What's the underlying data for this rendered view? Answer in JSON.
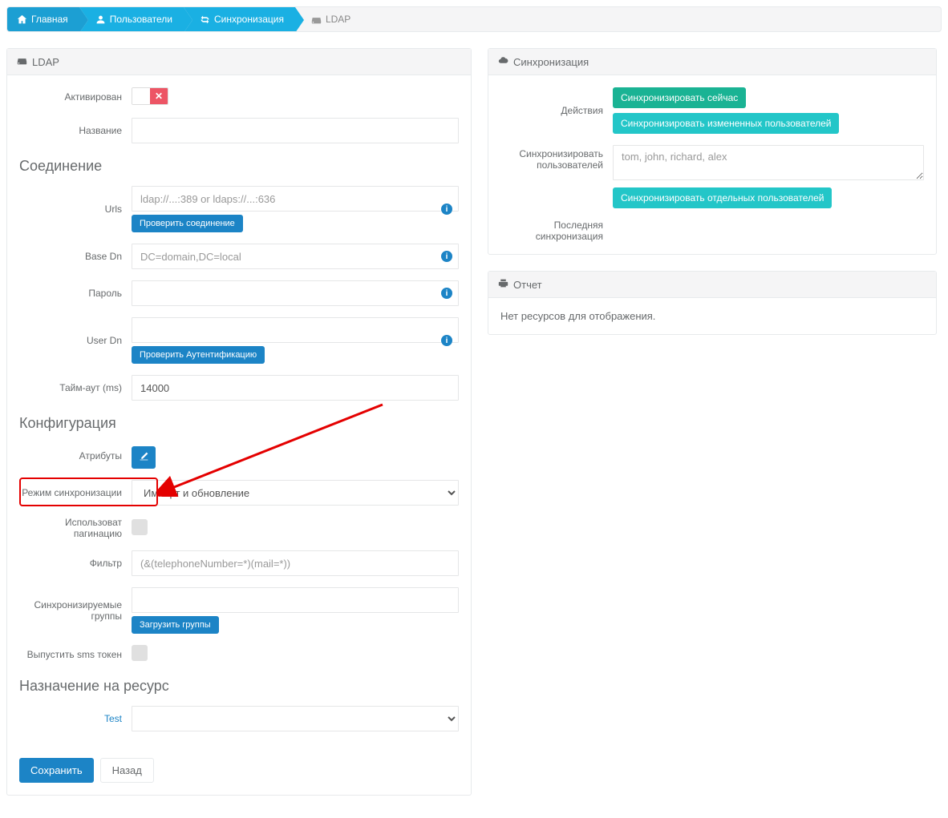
{
  "breadcrumb": {
    "home": "Главная",
    "users": "Пользователи",
    "sync": "Синхронизация",
    "ldap": "LDAP"
  },
  "ldap_panel": {
    "title": "LDAP",
    "activated_label": "Активирован",
    "name_label": "Название",
    "connection_title": "Соединение",
    "urls_label": "Urls",
    "urls_placeholder": "ldap://...:389 or ldaps://...:636",
    "check_connection": "Проверить соединение",
    "basedn_label": "Base Dn",
    "basedn_placeholder": "DC=domain,DC=local",
    "password_label": "Пароль",
    "userdn_label": "User Dn",
    "check_auth": "Проверить Аутентификацию",
    "timeout_label": "Тайм-аут (ms)",
    "timeout_value": "14000",
    "config_title": "Конфигурация",
    "attributes_label": "Атрибуты",
    "sync_mode_label": "Режим синхронизации",
    "sync_mode_value": "Импорт и обновление",
    "use_pagination_label": "Использоват пагинацию",
    "filter_label": "Фильтр",
    "filter_placeholder": "(&(telephoneNumber=*)(mail=*))",
    "sync_groups_label": "Синхронизируемые группы",
    "load_groups": "Загрузить группы",
    "issue_sms_label": "Выпустить sms токен",
    "resource_assign_title": "Назначение на ресурс",
    "test_label": "Test",
    "save": "Сохранить",
    "back": "Назад"
  },
  "sync_panel": {
    "title": "Синхронизация",
    "actions_label": "Действия",
    "sync_now": "Синхронизировать сейчас",
    "sync_changed": "Синхронизировать измененных пользователей",
    "sync_users_label": "Синхронизировать пользователей",
    "sync_users_placeholder": "tom, john, richard, alex",
    "sync_specific": "Синхронизировать отдельных пользователей",
    "last_sync_label": "Последняя синхронизация"
  },
  "report_panel": {
    "title": "Отчет",
    "empty": "Нет ресурсов для отображения."
  }
}
